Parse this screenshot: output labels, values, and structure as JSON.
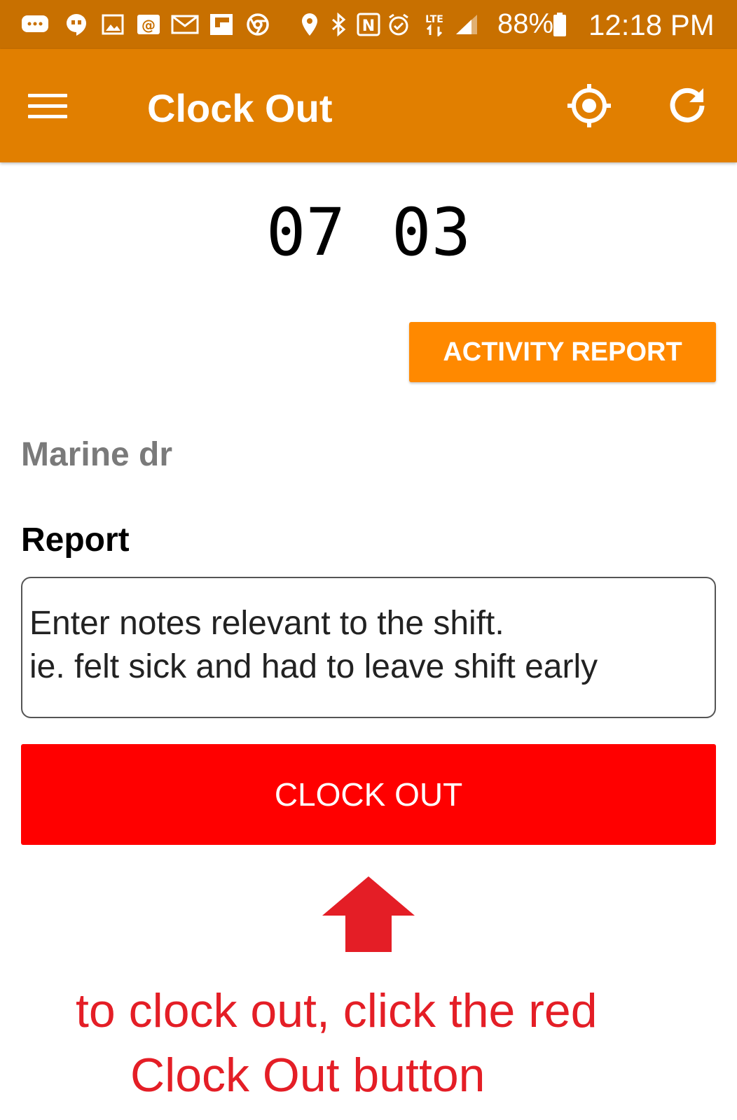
{
  "status_bar": {
    "icons": [
      "messages-icon",
      "hangouts-icon",
      "gallery-icon",
      "email-icon",
      "gmail-icon",
      "flipboard-icon",
      "chrome-icon",
      "location-pin-icon",
      "bluetooth-icon",
      "nfc-icon",
      "alarm-icon",
      "lte-icon",
      "signal-icon",
      "battery-icon"
    ],
    "network": "LTE",
    "battery": "88%",
    "time": "12:18 PM"
  },
  "app_bar": {
    "title": "Clock Out",
    "icons": [
      "menu-icon",
      "location-target-icon",
      "refresh-icon"
    ],
    "color": "#e17f00"
  },
  "timer": {
    "hours": "07",
    "minutes": "03"
  },
  "activity_report_button": {
    "label": "ACTIVITY REPORT",
    "color": "#ff8900"
  },
  "location_name": "Marine dr",
  "report": {
    "label": "Report",
    "placeholder": "Enter notes relevant to the shift.\nie. felt sick and had to leave shift early"
  },
  "clock_out_button": {
    "label": "CLOCK OUT",
    "color": "#ff0000"
  },
  "hint": {
    "line1": "to clock out, click the red",
    "line2": "Clock Out button",
    "color": "#e41e26"
  }
}
